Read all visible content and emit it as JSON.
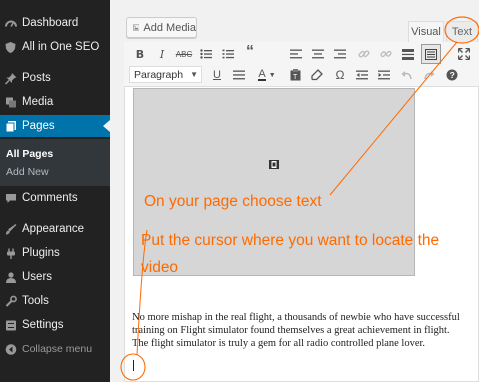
{
  "sidebar": {
    "items": [
      {
        "label": "Dashboard",
        "icon": "dashboard-icon"
      },
      {
        "label": "All in One SEO",
        "icon": "shield-icon"
      },
      {
        "label": "Posts",
        "icon": "pin-icon"
      },
      {
        "label": "Media",
        "icon": "media-icon"
      },
      {
        "label": "Pages",
        "icon": "pages-icon",
        "current": true
      },
      {
        "label": "Comments",
        "icon": "comment-icon"
      },
      {
        "label": "Appearance",
        "icon": "brush-icon"
      },
      {
        "label": "Plugins",
        "icon": "plug-icon"
      },
      {
        "label": "Users",
        "icon": "user-icon"
      },
      {
        "label": "Tools",
        "icon": "wrench-icon"
      },
      {
        "label": "Settings",
        "icon": "settings-icon"
      },
      {
        "label": "Collapse menu",
        "icon": "collapse-icon"
      }
    ],
    "submenu": [
      {
        "label": "All Pages",
        "current": true
      },
      {
        "label": "Add New"
      }
    ]
  },
  "editor": {
    "add_media_label": "Add Media",
    "tabs": {
      "visual": "Visual",
      "text": "Text"
    },
    "format_select": "Paragraph",
    "toolbar_row1": [
      "bold-icon",
      "italic-icon",
      "strikethrough-icon",
      "bullet-list-icon",
      "numbered-list-icon",
      "blockquote-icon",
      "align-left-icon",
      "align-center-icon",
      "align-right-icon",
      "link-icon",
      "unlink-icon",
      "read-more-icon",
      "toolbar-toggle-icon",
      "fullscreen-icon"
    ],
    "toolbar_row2": [
      "underline-icon",
      "justify-icon",
      "text-color-icon",
      "paste-text-icon",
      "clear-formatting-icon",
      "special-char-icon",
      "outdent-icon",
      "indent-icon",
      "undo-icon",
      "redo-icon",
      "help-icon"
    ],
    "paragraph_lines": [
      "No more mishap in the real flight, a thousands of newbie who have successful",
      "training on Flight simulator found themselves a great achievement in flight.",
      "The flight simulator is truly a gem for all radio controlled plane lover."
    ]
  },
  "annotations": {
    "text1": "On your page choose text",
    "text2": "Put the cursor where you want to locate the",
    "text3": "video"
  },
  "colors": {
    "sidebar_bg": "#222222",
    "current_menu": "#0073aa",
    "annotation": "#ff6a00"
  }
}
